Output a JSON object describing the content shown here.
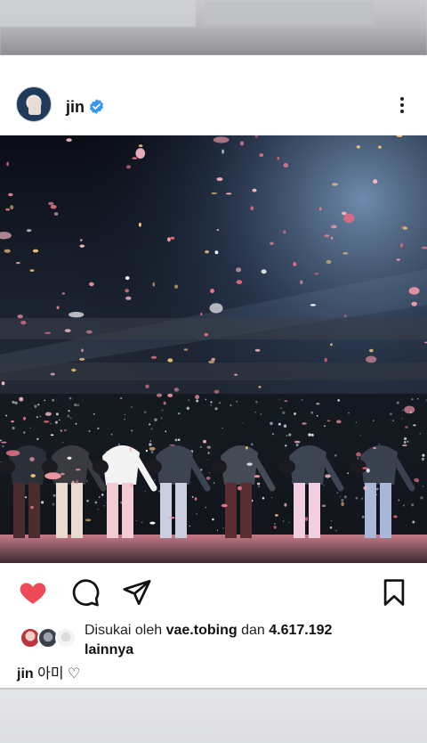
{
  "post": {
    "username": "jin",
    "verified": true,
    "avatar_icon": "profile-avatar",
    "more_icon": "more-vertical-icon",
    "image_alt": "concert-stage-confetti-photo",
    "actions": {
      "like_icon": "heart-filled-icon",
      "comment_icon": "comment-icon",
      "share_icon": "send-icon",
      "save_icon": "bookmark-icon",
      "like_color": "#ed4956"
    },
    "likes": {
      "prefix": "Disukai oleh",
      "user": "vae.tobing",
      "conjunction": "dan",
      "count": "4.617.192",
      "suffix": "lainnya"
    },
    "caption": {
      "user": "jin",
      "text": "아미 ♡"
    }
  },
  "colors": {
    "verified_blue": "#3897f0",
    "text": "#111111"
  }
}
